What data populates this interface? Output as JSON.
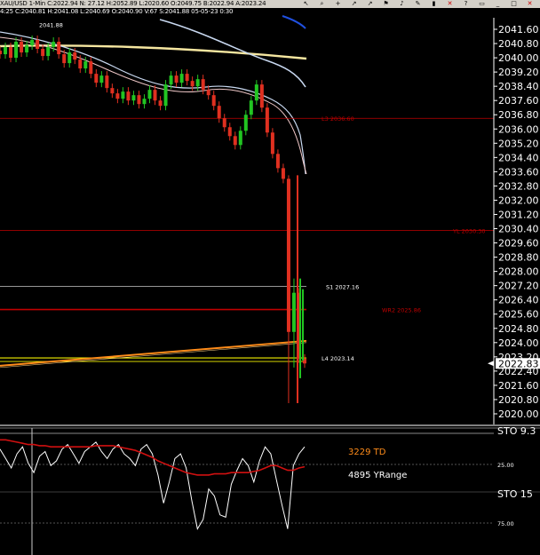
{
  "toolbar": {
    "info": "XAU/USD 1-Min C:2022.94 N: 27.12 H:2052.89 L:2020.60 O:2049.75 B:2022.94 A:2023.24",
    "secondary_info": "4:25 C:2040.81 H:2041.08 L:2040.69 O:2040.90 V:67 S:2041.88 05-05-23 0:30",
    "buttons": [
      "cursor-icon",
      "zoom-icon",
      "crosshair-icon",
      "arrow-icon",
      "arrow-icon",
      "flag-icon",
      "bell-icon",
      "draw-icon",
      "bookmark-icon",
      "close-icon",
      "question-icon",
      "window-icon",
      "minimize-icon",
      "maximize-icon",
      "close-window-icon"
    ]
  },
  "colors": {
    "background": "#000000",
    "candle_up": "#22c522",
    "candle_down": "#e03020",
    "level_red": "#c00000",
    "level_orange": "#ff8c1a",
    "level_yellow": "#f2f000",
    "ma_light": "#c8d8f0",
    "ma_cream": "#f5e6a0",
    "sto_white": "#ffffff",
    "sto_red": "#d01010"
  },
  "chart_data": [
    {
      "type": "candlestick",
      "title": "XAU/USD 1-Min",
      "ylim": [
        2019.9,
        2042.3
      ],
      "y_ticks": [
        "2041.60",
        "2040.80",
        "2040.00",
        "2039.20",
        "2038.40",
        "2037.60",
        "2036.80",
        "2036.00",
        "2035.20",
        "2034.40",
        "2033.60",
        "2032.80",
        "2032.00",
        "2031.20",
        "2030.40",
        "2029.60",
        "2028.80",
        "2028.00",
        "2027.20",
        "2026.40",
        "2025.60",
        "2024.80",
        "2024.00",
        "2023.20",
        "2022.40",
        "2021.60",
        "2020.80",
        "2020.00"
      ],
      "current_price": "2022.83",
      "annotations": [
        {
          "text": "2041.88",
          "y": 2041.88
        }
      ],
      "levels": [
        {
          "name": "L3",
          "label": "L3  2036.60",
          "value": 2036.6,
          "color": "#c00000"
        },
        {
          "name": "YL",
          "label": "YL  2030.30",
          "value": 2030.3,
          "color": "#c00000"
        },
        {
          "name": "S1",
          "label": "S1  2027.16",
          "value": 2027.16,
          "color": "#c8c8c8"
        },
        {
          "name": "WR2",
          "label": "WR2  2025.86",
          "value": 2025.86,
          "color": "#c00000"
        },
        {
          "name": "L4",
          "label": "L4  2023.14",
          "value": 2023.14,
          "color": "#f2f000"
        }
      ],
      "ohlc_close_sample": [
        2040.2,
        2040.6,
        2040.0,
        2040.9,
        2040.3,
        2040.7,
        2041.0,
        2040.5,
        2040.1,
        2040.6,
        2040.9,
        2040.2,
        2039.7,
        2040.3,
        2039.9,
        2039.4,
        2039.8,
        2039.1,
        2038.6,
        2039.0,
        2038.3,
        2038.0,
        2037.7,
        2038.1,
        2037.6,
        2037.9,
        2037.4,
        2037.7,
        2038.2,
        2037.6,
        2037.3,
        2038.5,
        2039.0,
        2038.6,
        2039.1,
        2038.7,
        2038.4,
        2038.8,
        2038.2,
        2037.9,
        2037.3,
        2036.6,
        2036.1,
        2035.6,
        2035.1,
        2035.9,
        2036.8,
        2037.6,
        2038.5,
        2037.2,
        2035.8,
        2034.6,
        2033.8,
        2033.2,
        2024.6,
        2026.8,
        2023.1,
        2022.83
      ]
    },
    {
      "type": "line",
      "title": "STO",
      "labels": [
        "3229 TD",
        "4895 YRange"
      ],
      "y_ticks": [
        "25.00",
        "75.00"
      ],
      "sto_label": "STO  15",
      "sto_top_label": "STO  9.3",
      "ylim": [
        0,
        100
      ],
      "series": [
        {
          "values": [
            88,
            80,
            72,
            84,
            90,
            76,
            68,
            82,
            86,
            74,
            78,
            88,
            92,
            84,
            76,
            86,
            90,
            94,
            86,
            80,
            88,
            92,
            84,
            80,
            74,
            88,
            92,
            84,
            66,
            42,
            60,
            80,
            84,
            72,
            44,
            20,
            28,
            54,
            48,
            32,
            30,
            58,
            70,
            80,
            74,
            60,
            78,
            90,
            84,
            62,
            40,
            20,
            74,
            84,
            90
          ]
        },
        {
          "values": [
            96,
            96,
            95,
            94,
            93,
            92,
            92,
            91,
            91,
            90,
            90,
            90,
            90,
            90,
            90,
            90,
            90,
            91,
            91,
            91,
            91,
            90,
            89,
            88,
            87,
            85,
            83,
            81,
            78,
            76,
            74,
            72,
            70,
            68,
            67,
            66,
            66,
            66,
            67,
            67,
            67,
            68,
            68,
            68,
            68,
            69,
            70,
            72,
            74,
            74,
            72,
            70,
            70,
            72,
            73
          ]
        }
      ]
    }
  ]
}
